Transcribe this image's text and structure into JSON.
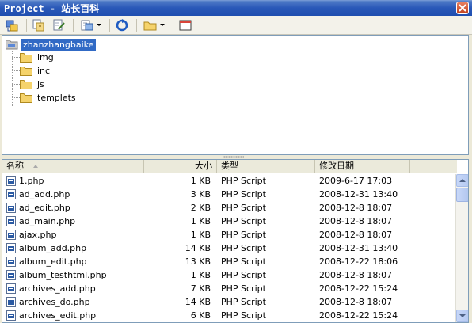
{
  "window": {
    "title": "Project - 站长百科"
  },
  "toolbar": {
    "buttons": [
      {
        "name": "connect-button",
        "icon": "connect-icon"
      },
      {
        "name": "refresh-files-button",
        "icon": "get-files-icon"
      },
      {
        "name": "check-out-button",
        "icon": "check-out-icon"
      },
      {
        "name": "manage-button",
        "icon": "manage-icon",
        "dropdown": true
      },
      {
        "name": "refresh-button",
        "icon": "refresh-icon"
      },
      {
        "name": "folder-button",
        "icon": "folder-icon",
        "dropdown": true
      },
      {
        "name": "expand-button",
        "icon": "window-icon"
      }
    ]
  },
  "tree": {
    "root": "zhanzhangbaike",
    "folders": [
      "img",
      "inc",
      "js",
      "templets"
    ]
  },
  "list": {
    "headers": {
      "name": "名称",
      "size": "大小",
      "type": "类型",
      "date": "修改日期"
    },
    "rows": [
      {
        "name": "1.php",
        "size": "1 KB",
        "type": "PHP Script",
        "date": "2009-6-17 17:03"
      },
      {
        "name": "ad_add.php",
        "size": "3 KB",
        "type": "PHP Script",
        "date": "2008-12-31 13:40"
      },
      {
        "name": "ad_edit.php",
        "size": "2 KB",
        "type": "PHP Script",
        "date": "2008-12-8 18:07"
      },
      {
        "name": "ad_main.php",
        "size": "1 KB",
        "type": "PHP Script",
        "date": "2008-12-8 18:07"
      },
      {
        "name": "ajax.php",
        "size": "1 KB",
        "type": "PHP Script",
        "date": "2008-12-8 18:07"
      },
      {
        "name": "album_add.php",
        "size": "14 KB",
        "type": "PHP Script",
        "date": "2008-12-31 13:40"
      },
      {
        "name": "album_edit.php",
        "size": "13 KB",
        "type": "PHP Script",
        "date": "2008-12-22 18:06"
      },
      {
        "name": "album_testhtml.php",
        "size": "1 KB",
        "type": "PHP Script",
        "date": "2008-12-8 18:07"
      },
      {
        "name": "archives_add.php",
        "size": "7 KB",
        "type": "PHP Script",
        "date": "2008-12-22 15:24"
      },
      {
        "name": "archives_do.php",
        "size": "14 KB",
        "type": "PHP Script",
        "date": "2008-12-8 18:07"
      },
      {
        "name": "archives_edit.php",
        "size": "6 KB",
        "type": "PHP Script",
        "date": "2008-12-22 15:24"
      }
    ]
  },
  "colors": {
    "titlebar": "#2a58b8",
    "selection": "#316ac5",
    "folder": "#f5d36b"
  }
}
